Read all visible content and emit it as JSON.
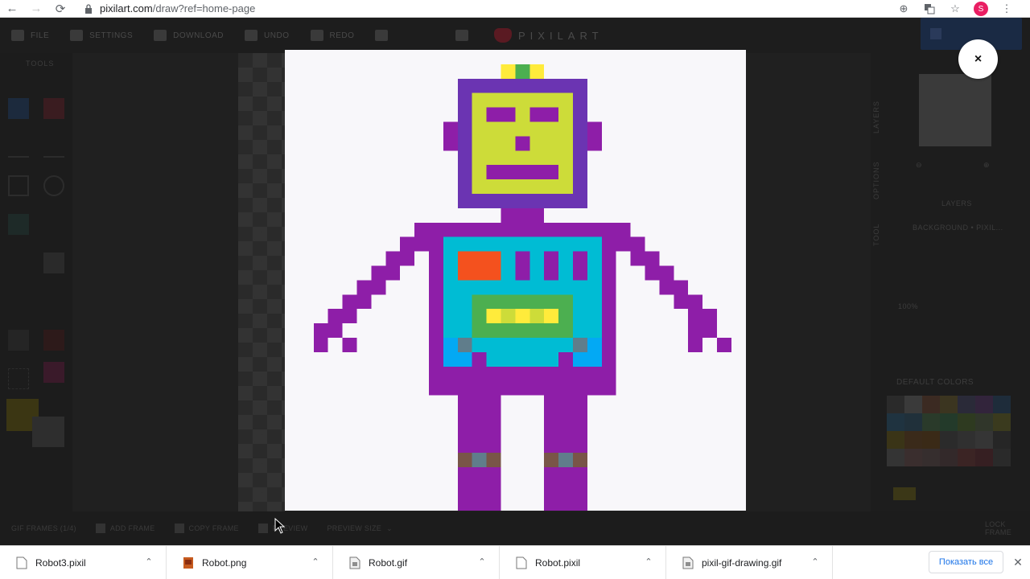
{
  "browser": {
    "url_host": "pixilart.com",
    "url_path": "/draw?ref=home-page",
    "avatar_letter": "S"
  },
  "app": {
    "topbar": {
      "file": "FILE",
      "settings": "SETTINGS",
      "download": "DOWNLOAD",
      "undo": "UNDO",
      "redo": "REDO",
      "logo": "PIXILART"
    },
    "tools_label": "TOOLS",
    "right_panel": {
      "tab_layers": "LAYERS",
      "tab_options": "OPTIONS",
      "tab_tool": "TOOL",
      "layers_label": "LAYERS",
      "layer_name": "BACKGROUND • PIXIL...",
      "zoom": "100%",
      "default_colors": "DEFAULT COLORS"
    },
    "bottom_bar": {
      "frames": "GIF FRAMES (1/4)",
      "add_frame": "ADD FRAME",
      "copy_frame": "COPY FRAME",
      "preview": "PREVIEW",
      "preview_size": "PREVIEW SIZE",
      "lock_frame": "LOCK FRAME"
    }
  },
  "modal": {
    "close_label": "×"
  },
  "downloads": {
    "items": [
      {
        "name": "Robot3.pixil",
        "type": "file"
      },
      {
        "name": "Robot.png",
        "type": "image"
      },
      {
        "name": "Robot.gif",
        "type": "file"
      },
      {
        "name": "Robot.pixil",
        "type": "file"
      },
      {
        "name": "pixil-gif-drawing.gif",
        "type": "file"
      }
    ],
    "show_all": "Показать все"
  },
  "colors": {
    "robot_purple": "#8e1ea8",
    "head_frame": "#6b34b2",
    "face": "#cddc39",
    "body": "#00bcd4",
    "panel_red": "#f4511e",
    "chest_green": "#4caf50",
    "yellow": "#ffeb3b",
    "hand_blue": "#03a9f4",
    "knee_brown": "#795548",
    "knee_grey": "#607d8b"
  }
}
